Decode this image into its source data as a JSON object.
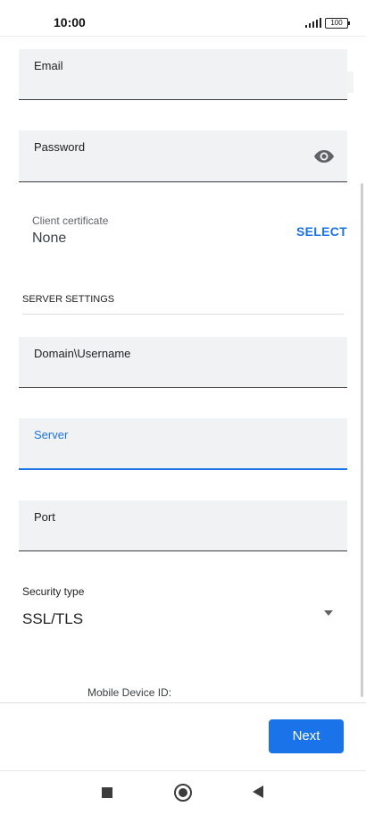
{
  "status_bar": {
    "time": "10:00",
    "battery": "100"
  },
  "form": {
    "email": {
      "label": "Email",
      "value": ""
    },
    "password": {
      "label": "Password",
      "value": ""
    },
    "client_certificate": {
      "label": "Client certificate",
      "value": "None",
      "action": "SELECT"
    },
    "server_settings_header": "SERVER SETTINGS",
    "domain_username": {
      "label": "Domain\\Username",
      "value": ""
    },
    "server": {
      "label": "Server",
      "value": ""
    },
    "port": {
      "label": "Port",
      "value": ""
    },
    "security_type": {
      "label": "Security type",
      "value": "SSL/TLS"
    },
    "mobile_device_id_label": "Mobile Device ID:"
  },
  "actions": {
    "next": "Next"
  },
  "colors": {
    "accent": "#1a73e8",
    "field_bg": "#f1f2f3"
  },
  "icons": [
    "visibility-eye-icon",
    "dropdown-arrow-icon",
    "signal-icon",
    "battery-icon",
    "nav-recent-icon",
    "nav-home-icon",
    "nav-back-icon"
  ]
}
